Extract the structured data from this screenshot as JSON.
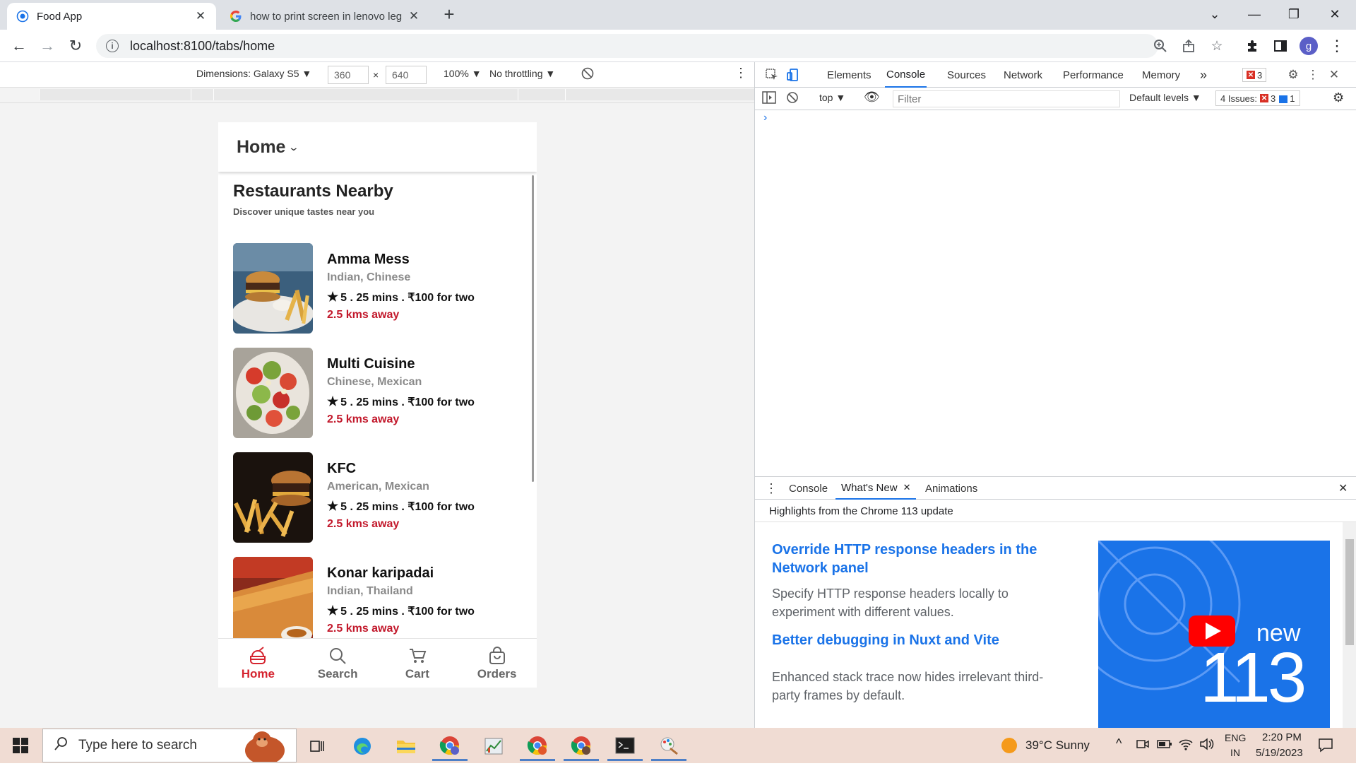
{
  "browser": {
    "tabs": [
      {
        "title": "Food App",
        "active": true
      },
      {
        "title": "how to print screen in lenovo leg",
        "active": false
      }
    ],
    "new_tab": "+",
    "url": "localhost:8100/tabs/home",
    "profile_initial": "g"
  },
  "device_toolbar": {
    "dimensions": "Dimensions: Galaxy S5 ▼",
    "width": "360",
    "height": "640",
    "times": "×",
    "zoom": "100% ▼",
    "throttling": "No throttling ▼"
  },
  "app": {
    "header_title": "Home",
    "section_title": "Restaurants Nearby",
    "section_subtitle": "Discover unique tastes near you",
    "restaurants": [
      {
        "name": "Amma Mess",
        "cuisine": "Indian, Chinese",
        "meta": "5 . 25 mins . ₹100 for two",
        "distance": "2.5 kms away"
      },
      {
        "name": "Multi Cuisine",
        "cuisine": "Chinese, Mexican",
        "meta": "5 . 25 mins . ₹100 for two",
        "distance": "2.5 kms away"
      },
      {
        "name": "KFC",
        "cuisine": "American, Mexican",
        "meta": "5 . 25 mins . ₹100 for two",
        "distance": "2.5 kms away"
      },
      {
        "name": "Konar karipadai",
        "cuisine": "Indian, Thailand",
        "meta": "5 . 25 mins . ₹100 for two",
        "distance": "2.5 kms away"
      }
    ],
    "tabs": [
      {
        "label": "Home",
        "active": true
      },
      {
        "label": "Search",
        "active": false
      },
      {
        "label": "Cart",
        "active": false
      },
      {
        "label": "Orders",
        "active": false
      }
    ],
    "accent": "#d5242f"
  },
  "devtools": {
    "tabs": [
      "Elements",
      "Console",
      "Sources",
      "Network",
      "Performance",
      "Memory"
    ],
    "active_tab": "Console",
    "more": "»",
    "error_count": "3",
    "context": "top ▼",
    "filter_placeholder": "Filter",
    "levels": "Default levels ▼",
    "issues_label": "4 Issues:",
    "issues_errors": "3",
    "issues_info": "1",
    "prompt": "›",
    "drawer": {
      "tabs": [
        "Console",
        "What's New",
        "Animations"
      ],
      "active_tab": "What's New",
      "highlights": "Highlights from the Chrome 113 update",
      "items": [
        {
          "heading": "Override HTTP response headers in the Network panel",
          "text": "Specify HTTP response headers locally to experiment with different values."
        },
        {
          "heading": "Better debugging in Nuxt and Vite",
          "text": "Enhanced stack trace now hides irrelevant third-party frames by default."
        }
      ],
      "banner_new": "new",
      "banner_version": "113"
    }
  },
  "taskbar": {
    "search_placeholder": "Type here to search",
    "weather": "39°C  Sunny",
    "lang_top": "ENG",
    "lang_bottom": "IN",
    "time": "2:20 PM",
    "date": "5/19/2023"
  }
}
